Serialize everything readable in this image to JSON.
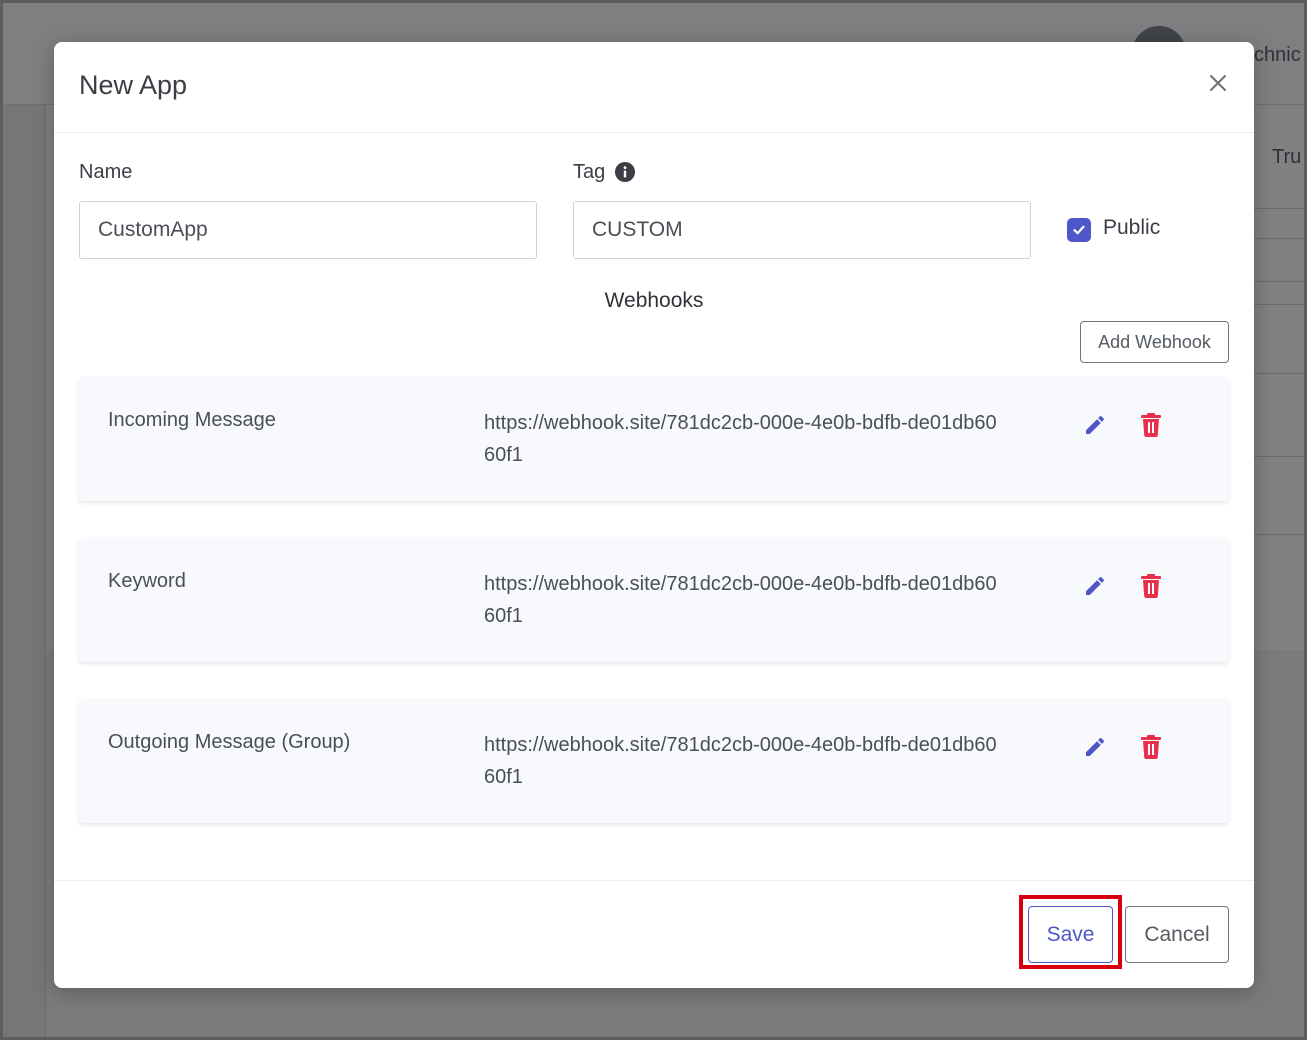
{
  "background": {
    "top_right_text": "chnic",
    "right_text": "Tru"
  },
  "modal": {
    "title": "New App",
    "close_icon": "close-icon",
    "name_label": "Name",
    "name_value": "CustomApp",
    "tag_label": "Tag",
    "tag_icon": "info-icon",
    "tag_value": "CUSTOM",
    "public_label": "Public",
    "public_checked": true,
    "webhooks_title": "Webhooks",
    "add_webhook_label": "Add Webhook",
    "webhooks": [
      {
        "name": "Incoming Message",
        "url": "https://webhook.site/781dc2cb-000e-4e0b-bdfb-de01db6060f1"
      },
      {
        "name": "Keyword",
        "url": "https://webhook.site/781dc2cb-000e-4e0b-bdfb-de01db6060f1"
      },
      {
        "name": "Outgoing Message (Group)",
        "url": "https://webhook.site/781dc2cb-000e-4e0b-bdfb-de01db6060f1"
      }
    ],
    "save_label": "Save",
    "cancel_label": "Cancel"
  },
  "colors": {
    "accent": "#4f56c8",
    "delete": "#e8304b",
    "highlight": "#d9000d"
  }
}
